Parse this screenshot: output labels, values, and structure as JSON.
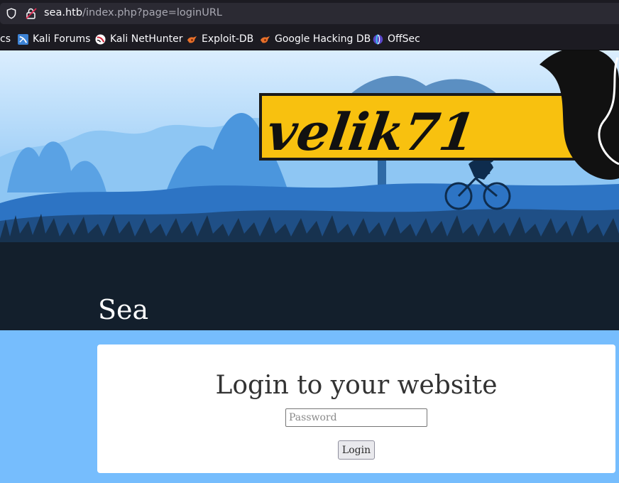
{
  "browser": {
    "url_host": "sea.htb",
    "url_path": "/index.php?page=loginURL"
  },
  "bookmarks": [
    {
      "label": "cs",
      "icon": "none"
    },
    {
      "label": "Kali Forums",
      "icon": "kali-forums-icon"
    },
    {
      "label": "Kali NetHunter",
      "icon": "kali-nethunter-icon"
    },
    {
      "label": "Exploit-DB",
      "icon": "exploit-db-icon"
    },
    {
      "label": "Google Hacking DB",
      "icon": "google-hacking-db-icon"
    },
    {
      "label": "OffSec",
      "icon": "offsec-icon"
    }
  ],
  "header": {
    "logo_text": "velik71",
    "site_title": "Sea"
  },
  "login": {
    "heading": "Login to your website",
    "password_placeholder": "Password",
    "password_value": "",
    "button_label": "Login"
  },
  "colors": {
    "page_background": "#76bdfd",
    "banner_dark": "#131f2c",
    "logo_yellow": "#f8c10f",
    "card_background": "#ffffff"
  }
}
